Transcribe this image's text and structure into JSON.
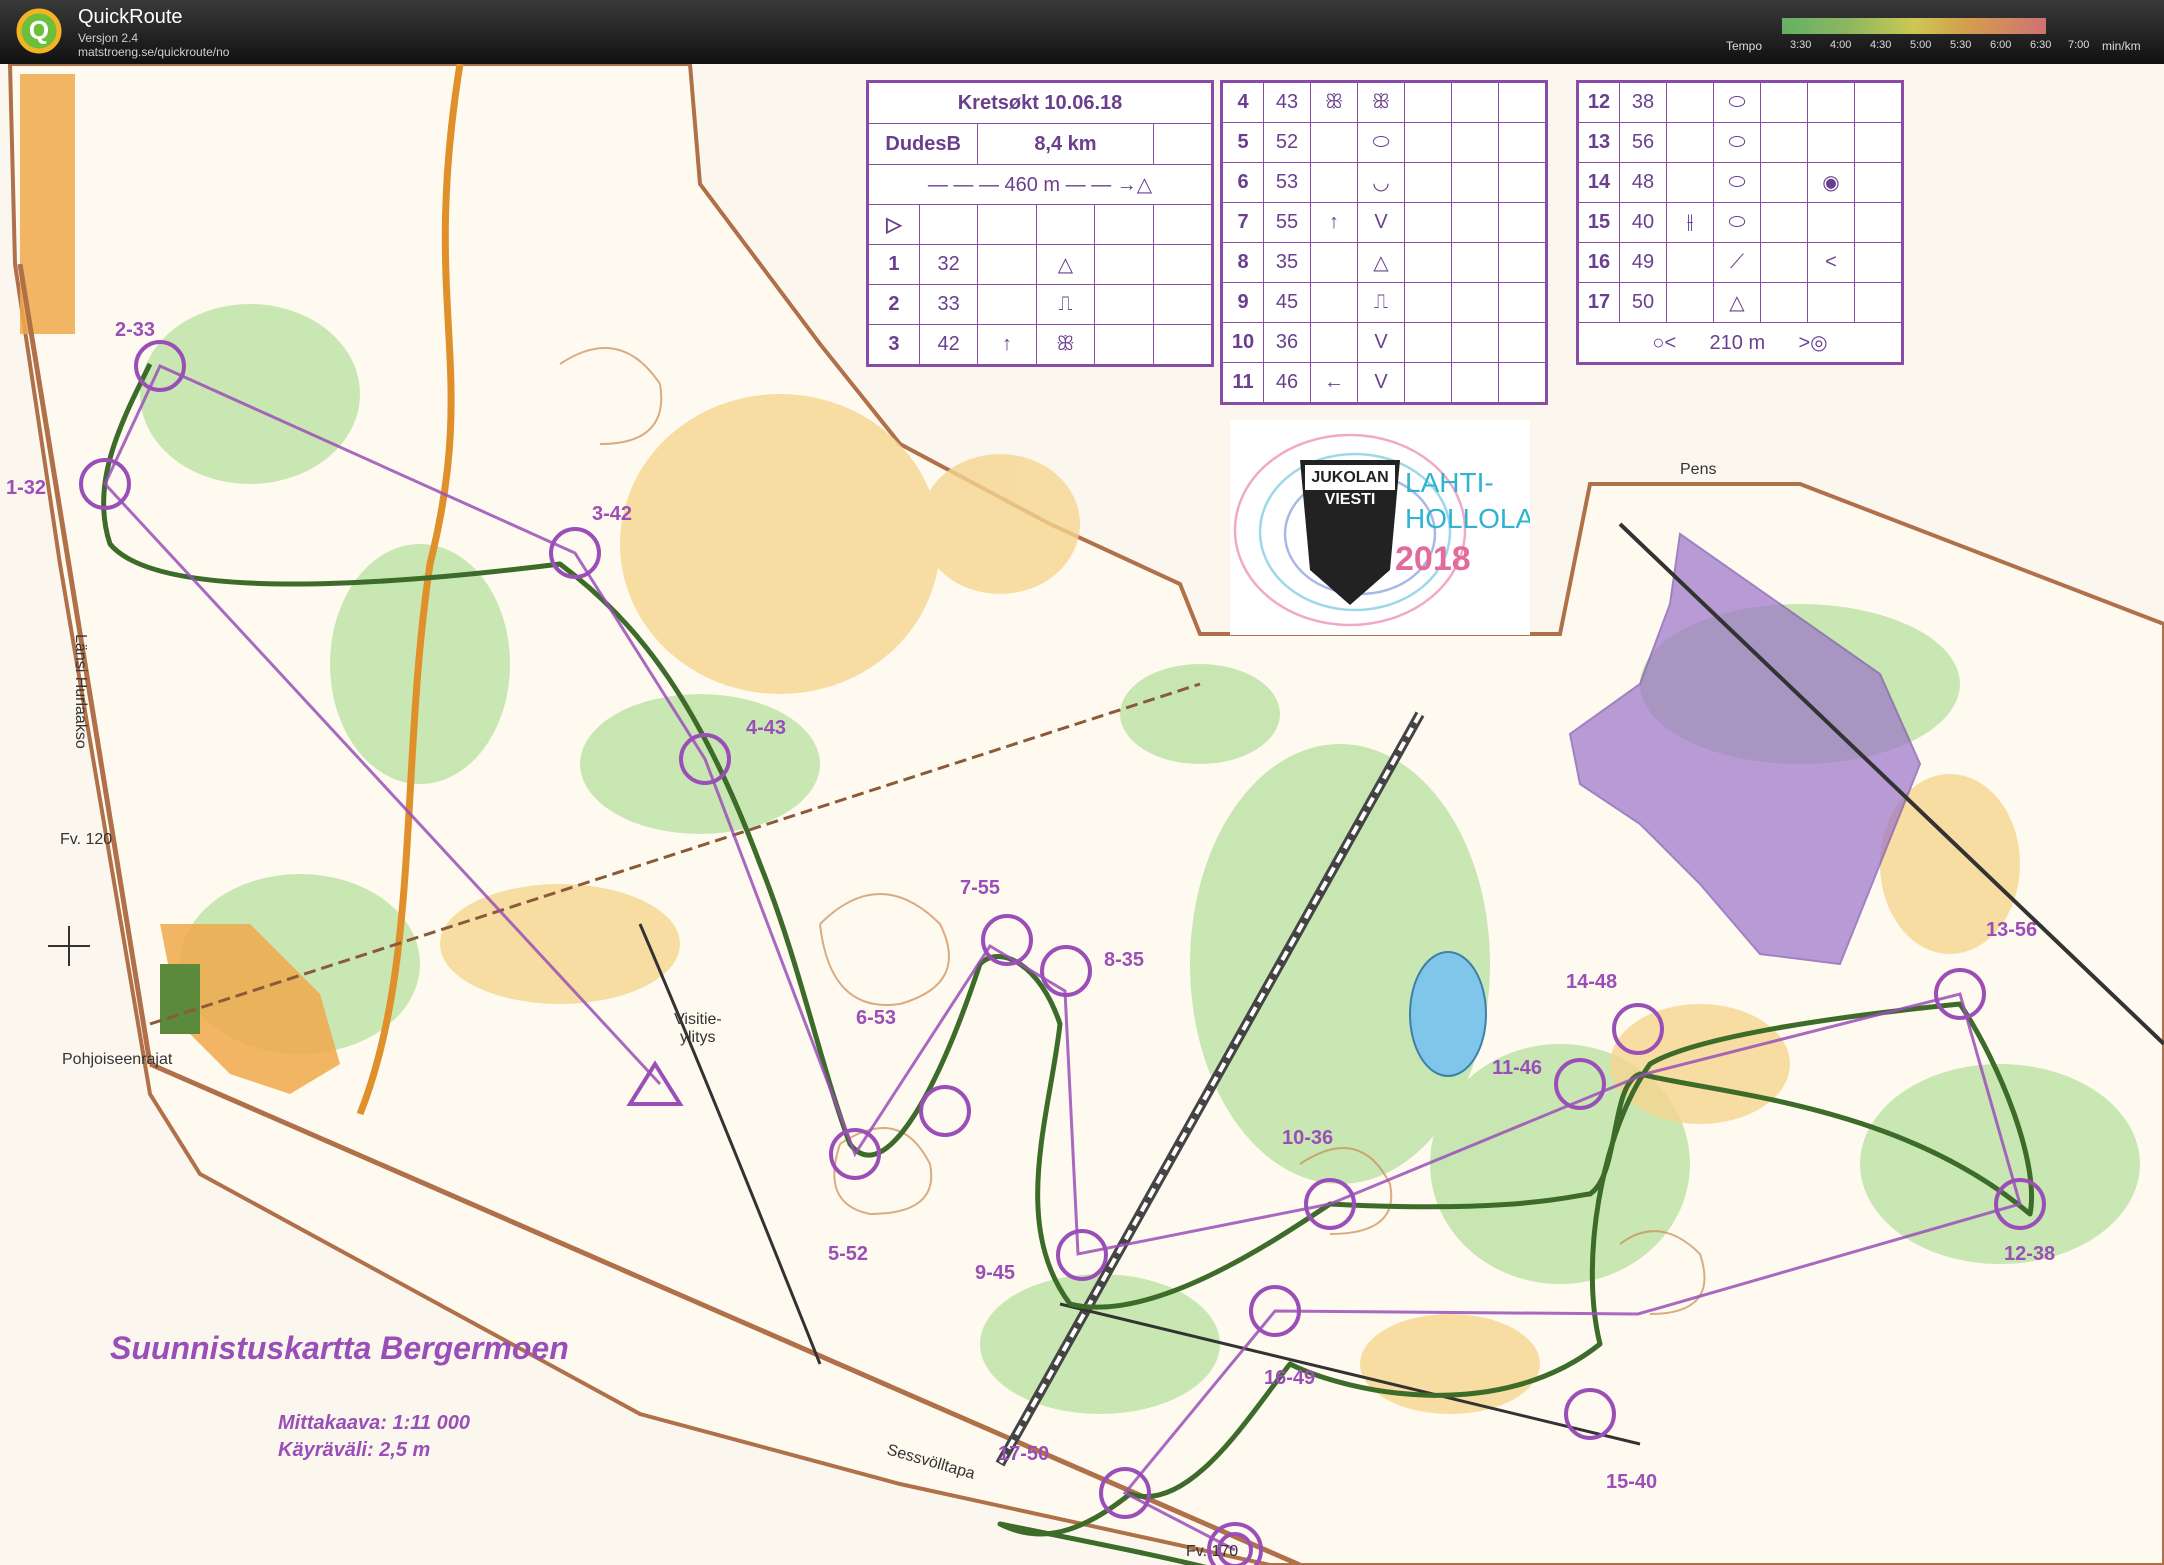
{
  "app": {
    "title": "QuickRoute",
    "version": "Versjon 2.4",
    "url": "matstroeng.se/quickroute/no"
  },
  "tempo": {
    "label": "Tempo",
    "ticks": [
      "3:30",
      "4:00",
      "4:30",
      "5:00",
      "5:30",
      "6:00",
      "6:30",
      "7:00"
    ],
    "unit": "min/km"
  },
  "map": {
    "title": "Suunnistuskartta Bergermoen",
    "scale": "Mittakaava: 1:11 000",
    "contour": "Käyräväli: 2,5 m",
    "places": [
      {
        "id": "lansi",
        "text": "Länsi Hurlaakso"
      },
      {
        "id": "fv120",
        "text": "Fv. 120"
      },
      {
        "id": "pohjoiseenrajat",
        "text": "Pohjoiseenrajat"
      },
      {
        "id": "sessvolltapa",
        "text": "Sessvölltapa"
      },
      {
        "id": "fv170",
        "text": "Fv. 170"
      },
      {
        "id": "pens",
        "text": "Pens"
      },
      {
        "id": "visitie1",
        "text": "Visitie-"
      },
      {
        "id": "visitie2",
        "text": "ylitys"
      }
    ],
    "controls": [
      {
        "label": "1-32"
      },
      {
        "label": "2-33"
      },
      {
        "label": "3-42"
      },
      {
        "label": "4-43"
      },
      {
        "label": "5-52"
      },
      {
        "label": "6-53"
      },
      {
        "label": "7-55"
      },
      {
        "label": "8-35"
      },
      {
        "label": "9-45"
      },
      {
        "label": "10-36"
      },
      {
        "label": "11-46"
      },
      {
        "label": "12-38"
      },
      {
        "label": "13-56"
      },
      {
        "label": "14-48"
      },
      {
        "label": "15-40"
      },
      {
        "label": "16-49"
      },
      {
        "label": "17-50"
      }
    ]
  },
  "description": {
    "event": "Kretsøkt 10.06.18",
    "class": "DudesB",
    "length": "8,4 km",
    "taped": "460 m",
    "finish": "210 m",
    "rows": [
      {
        "n": "1",
        "code": "32",
        "c": "",
        "d": "△"
      },
      {
        "n": "2",
        "code": "33",
        "c": "",
        "d": "⎍"
      },
      {
        "n": "3",
        "code": "42",
        "c": "↑",
        "d": "ꕥ"
      },
      {
        "n": "4",
        "code": "43",
        "c": "ꕥ",
        "d": "ꕥ"
      },
      {
        "n": "5",
        "code": "52",
        "c": "",
        "d": "⬭"
      },
      {
        "n": "6",
        "code": "53",
        "c": "",
        "d": "◡"
      },
      {
        "n": "7",
        "code": "55",
        "c": "↑",
        "d": "V"
      },
      {
        "n": "8",
        "code": "35",
        "c": "",
        "d": "△"
      },
      {
        "n": "9",
        "code": "45",
        "c": "",
        "d": "⎍"
      },
      {
        "n": "10",
        "code": "36",
        "c": "",
        "d": "V"
      },
      {
        "n": "11",
        "code": "46",
        "c": "←",
        "d": "V"
      },
      {
        "n": "12",
        "code": "38",
        "c": "",
        "d": "⬭"
      },
      {
        "n": "13",
        "code": "56",
        "c": "",
        "d": "⬭"
      },
      {
        "n": "14",
        "code": "48",
        "c": "",
        "d": "⬭"
      },
      {
        "n": "15",
        "code": "40",
        "c": "⫲",
        "d": "⬭"
      },
      {
        "n": "16",
        "code": "49",
        "c": "",
        "d": "⟋"
      },
      {
        "n": "17",
        "code": "50",
        "c": "",
        "d": "△"
      }
    ]
  },
  "jukola": {
    "line1": "JUKOLAN",
    "line2": "VIESTI",
    "city1": "LAHTI-",
    "city2": "HOLLOLA",
    "year": "2018"
  },
  "colors": {
    "course": "#9a4fb8",
    "route": "#3d6b2a",
    "road": "#e0902a",
    "green": "#bfe3a8",
    "yellow": "#f6d690"
  }
}
